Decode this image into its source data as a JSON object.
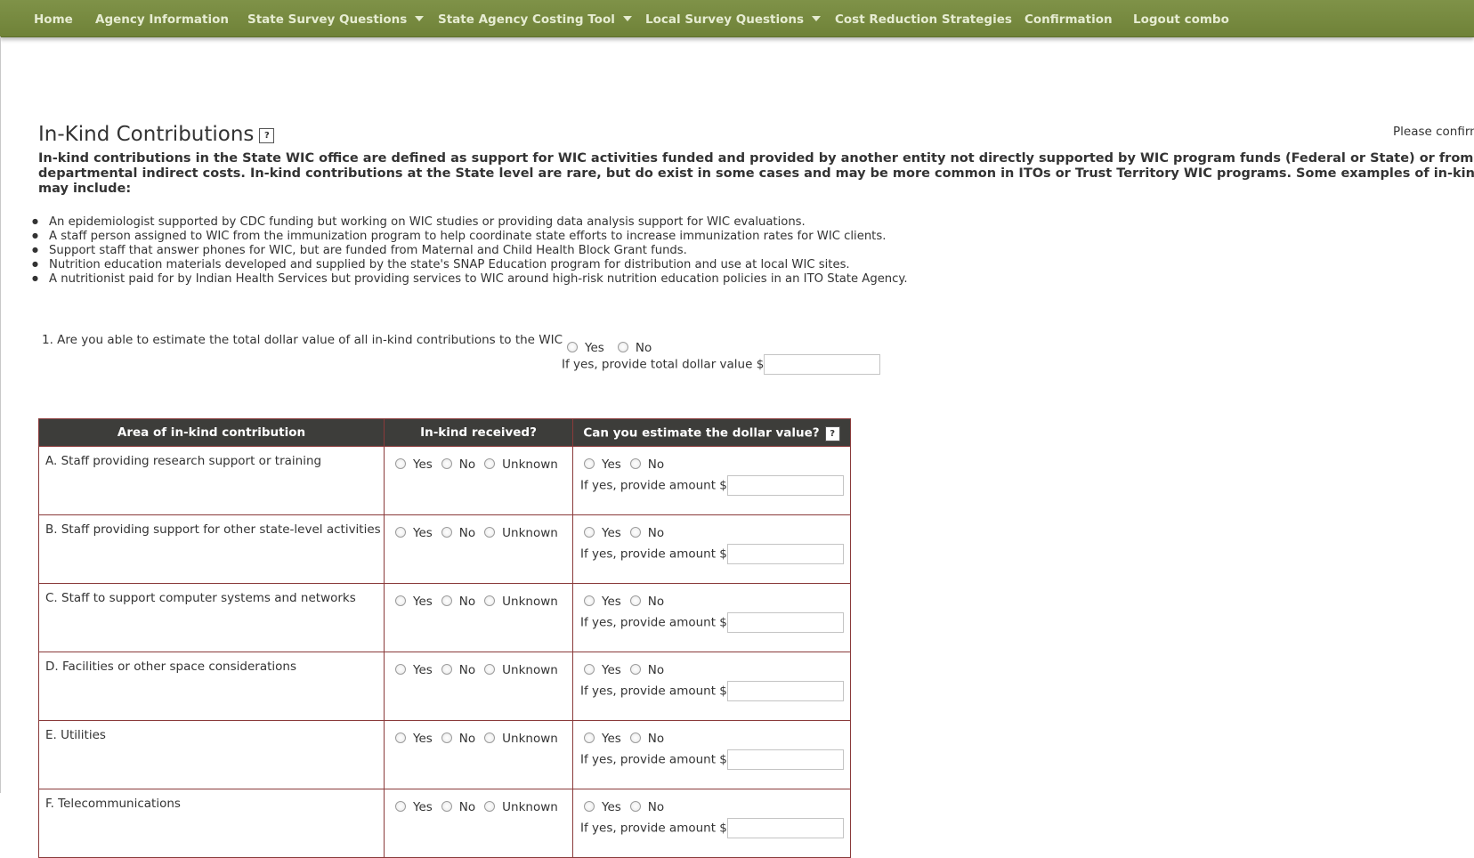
{
  "nav": {
    "items": [
      {
        "label": "Home",
        "dropdown": false
      },
      {
        "label": "Agency Information",
        "dropdown": false
      },
      {
        "label": "State Survey Questions",
        "dropdown": true
      },
      {
        "label": "State Agency Costing Tool",
        "dropdown": true
      },
      {
        "label": "Local Survey Questions",
        "dropdown": true
      },
      {
        "label": "Cost Reduction Strategies",
        "dropdown": false
      },
      {
        "label": "Confirmation",
        "dropdown": false
      },
      {
        "label": "Logout combo",
        "dropdown": false
      }
    ]
  },
  "page": {
    "title": "In-Kind Contributions",
    "help_label": "?",
    "confirm_text": "Please confirm",
    "intro_lines": [
      "In-kind contributions in the State WIC office are defined as support for WIC activities funded and provided by another entity not directly supported by WIC program funds (Federal or State) or from",
      "departmental indirect costs. In-kind contributions at the State level are rare, but do exist in some cases and may be more common in ITOs or Trust Territory WIC programs. Some examples of in-kind support",
      "may include:"
    ],
    "bullets": [
      "An epidemiologist supported by CDC funding but working on WIC studies or providing data analysis support for WIC evaluations.",
      "A staff person assigned to WIC from the immunization program to help coordinate state efforts to increase immunization rates for WIC clients.",
      "Support staff that answer phones for WIC, but are funded from Maternal and Child Health Block Grant funds.",
      "Nutrition education materials developed and supplied by the state's SNAP Education program for distribution and use at local WIC sites.",
      "A nutritionist paid for by Indian Health Services but providing services to WIC around high-risk nutrition education policies in an ITO State Agency."
    ]
  },
  "question1": {
    "text": "1. Are you able to estimate the total dollar value of all in-kind contributions to the WIC",
    "yes": "Yes",
    "no": "No",
    "amount_label": "If yes, provide total dollar value $",
    "amount_value": ""
  },
  "table": {
    "headers": [
      "Area of in-kind contribution",
      "In-kind received?",
      "Can you estimate the dollar value?"
    ],
    "header_help": "?",
    "received_options": [
      "Yes",
      "No",
      "Unknown"
    ],
    "estimate_options": [
      "Yes",
      "No"
    ],
    "amount_label": "If yes, provide amount $",
    "rows": [
      {
        "area": "A. Staff providing research support or training",
        "amount": ""
      },
      {
        "area": "B. Staff providing support for other state-level activities",
        "amount": ""
      },
      {
        "area": "C. Staff to support computer systems and networks",
        "amount": ""
      },
      {
        "area": "D. Facilities or other space considerations",
        "amount": ""
      },
      {
        "area": "E. Utilities",
        "amount": ""
      },
      {
        "area": "F. Telecommunications",
        "amount": ""
      }
    ]
  },
  "colors": {
    "nav_bg": "#74873d",
    "nav_text": "#e6ecd2",
    "table_header_bg": "#3d3d3a",
    "table_border": "#8a3a3a"
  }
}
